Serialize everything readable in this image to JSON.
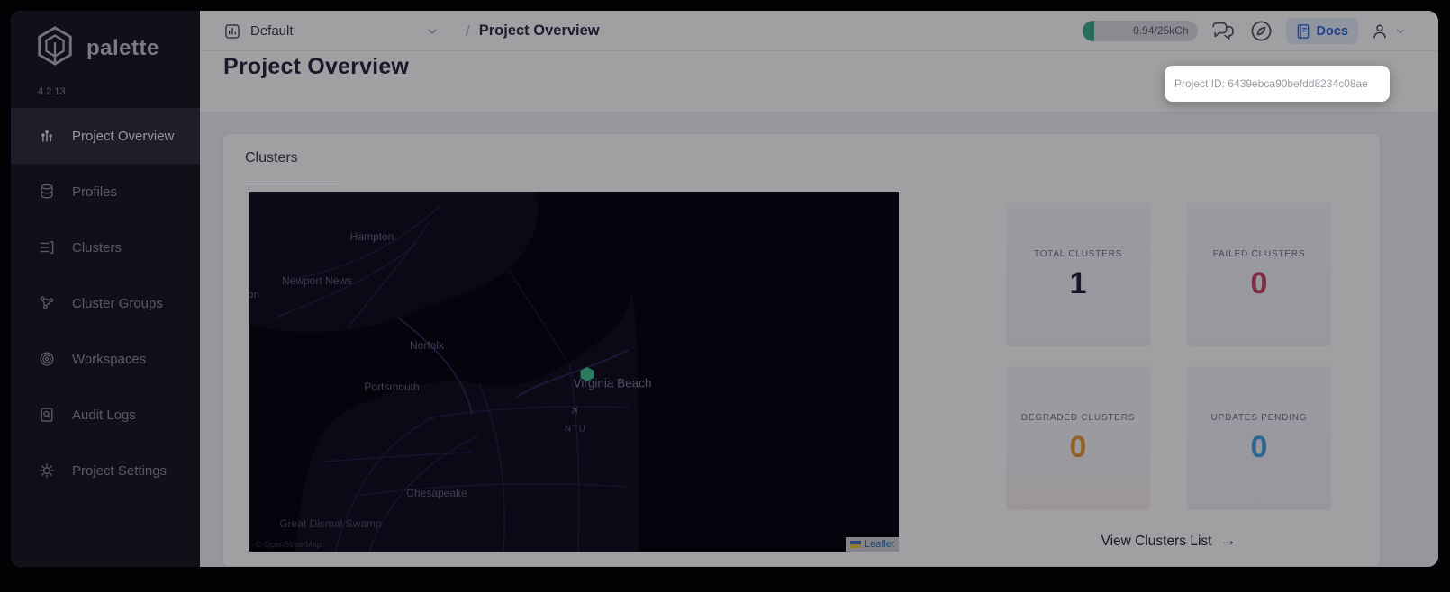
{
  "app": {
    "name": "palette",
    "version": "4.2.13"
  },
  "sidebar": {
    "items": [
      {
        "label": "Project Overview",
        "icon": "project-overview-icon",
        "active": true
      },
      {
        "label": "Profiles",
        "icon": "profiles-icon",
        "active": false
      },
      {
        "label": "Clusters",
        "icon": "clusters-icon",
        "active": false
      },
      {
        "label": "Cluster Groups",
        "icon": "cluster-groups-icon",
        "active": false
      },
      {
        "label": "Workspaces",
        "icon": "workspaces-icon",
        "active": false
      },
      {
        "label": "Audit Logs",
        "icon": "audit-logs-icon",
        "active": false
      },
      {
        "label": "Project Settings",
        "icon": "settings-icon",
        "active": false
      }
    ]
  },
  "topbar": {
    "project_selector": {
      "label": "Default"
    },
    "breadcrumb": {
      "separator": "/",
      "current": "Project Overview"
    },
    "usage": {
      "text": "0.94/25kCh",
      "bar_color": "#3fae8c"
    },
    "docs_button": {
      "label": "Docs",
      "color": "#2b6cd4"
    }
  },
  "tooltip": {
    "text": "Project ID: 6439ebca90befdd8234c08ae"
  },
  "main": {
    "title": "Project Overview",
    "panel": {
      "tab_label": "Clusters",
      "view_link_label": "View Clusters List",
      "view_link_arrow": "→"
    }
  },
  "stats": [
    {
      "label": "TOTAL CLUSTERS",
      "value": "1",
      "color": "#23233a"
    },
    {
      "label": "FAILED CLUSTERS",
      "value": "0",
      "color": "#c8415e"
    },
    {
      "label": "DEGRADED CLUSTERS",
      "value": "0",
      "color": "#e89a3c"
    },
    {
      "label": "UPDATES PENDING",
      "value": "0",
      "color": "#44a3e3"
    }
  ],
  "map": {
    "cities": [
      {
        "name": "Hampton"
      },
      {
        "name": "Newport News"
      },
      {
        "name": "llton"
      },
      {
        "name": "Norfolk"
      },
      {
        "name": "Portsmouth"
      },
      {
        "name": "Virginia Beach"
      },
      {
        "name": "Chesapeake"
      },
      {
        "name": "Great Dismal Swamp"
      }
    ],
    "airport_code": "NTU",
    "marker_color": "#43c492",
    "attribution": "© OpenStreetMap",
    "leaflet_label": "Leaflet"
  }
}
